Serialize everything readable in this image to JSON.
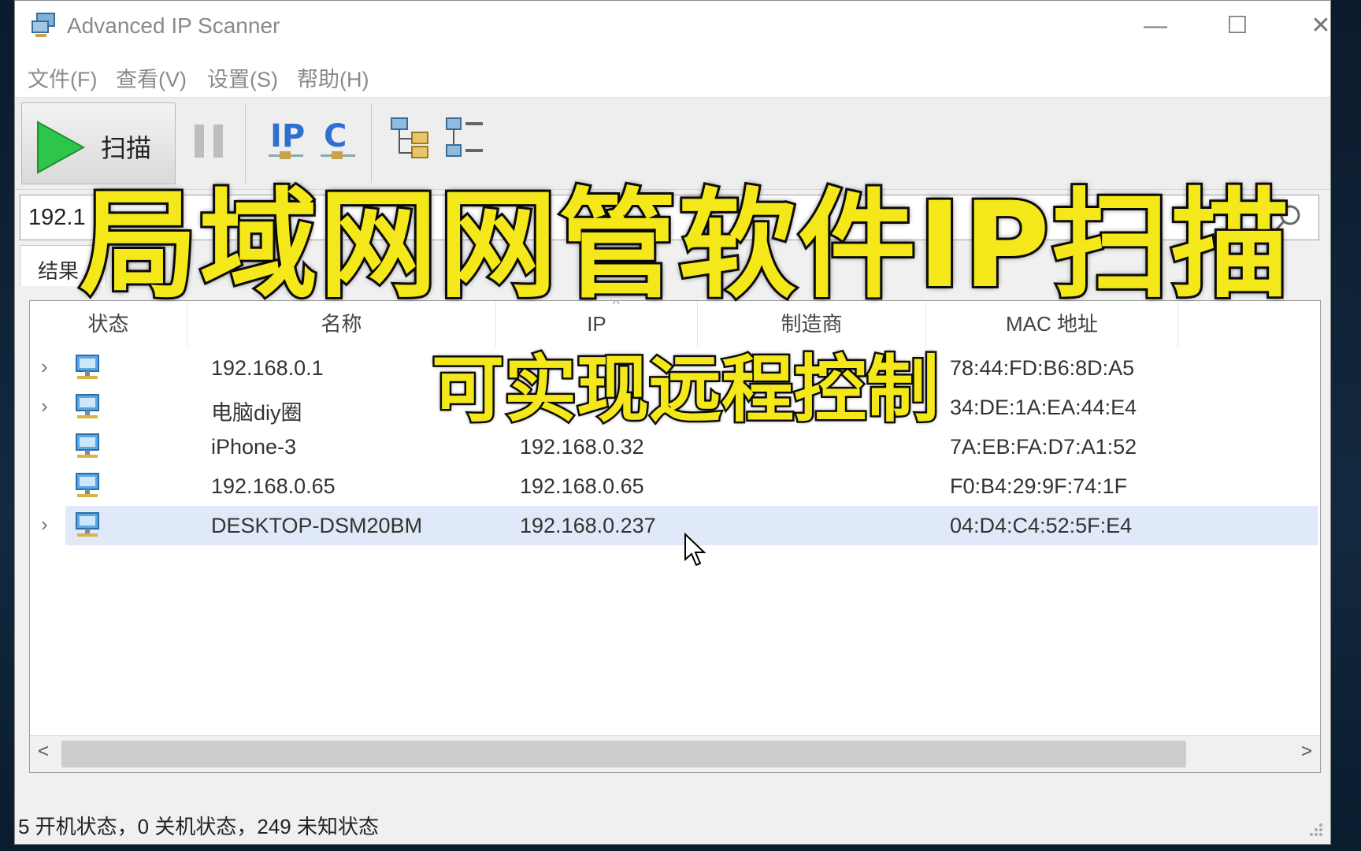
{
  "window": {
    "title": "Advanced IP Scanner",
    "controls": {
      "minimize": "—",
      "maximize": "☐",
      "close": "✕"
    }
  },
  "menu": {
    "items": [
      {
        "label": "文件(F)"
      },
      {
        "label": "查看(V)"
      },
      {
        "label": "设置(S)"
      },
      {
        "label": "帮助(H)"
      }
    ]
  },
  "toolbar": {
    "scan_label": "扫描",
    "icons": [
      "play-icon",
      "pause-icon",
      "ip-class-icon",
      "c-class-icon",
      "expand-all-icon",
      "collapse-all-icon"
    ]
  },
  "address_bar": {
    "value": "192.1",
    "search_icon": "search-icon"
  },
  "tabs": {
    "results": "结果"
  },
  "table": {
    "columns": [
      "状态",
      "名称",
      "IP",
      "制造商",
      "MAC 地址"
    ],
    "rows": [
      {
        "expandable": true,
        "name": "192.168.0.1",
        "ip": "",
        "vendor": "",
        "mac": "78:44:FD:B6:8D:A5"
      },
      {
        "expandable": true,
        "name": "电脑diy圈",
        "ip": "",
        "vendor": "",
        "mac": "34:DE:1A:EA:44:E4"
      },
      {
        "expandable": false,
        "name": "iPhone-3",
        "ip": "192.168.0.32",
        "vendor": "",
        "mac": "7A:EB:FA:D7:A1:52"
      },
      {
        "expandable": false,
        "name": "192.168.0.65",
        "ip": "192.168.0.65",
        "vendor": "",
        "mac": "F0:B4:29:9F:74:1F"
      },
      {
        "expandable": true,
        "name": "DESKTOP-DSM20BM",
        "ip": "192.168.0.237",
        "vendor": "",
        "mac": "04:D4:C4:52:5F:E4",
        "selected": true
      }
    ]
  },
  "status": {
    "text": "5 开机状态，0 关机状态，249 未知状态"
  },
  "overlay": {
    "title": "局域网网管软件IP扫描",
    "subtitle": "可实现远程控制"
  },
  "colors": {
    "overlay_text": "#f4e81a",
    "selection": "#dfe9f7",
    "play_green": "#2fc44a"
  }
}
